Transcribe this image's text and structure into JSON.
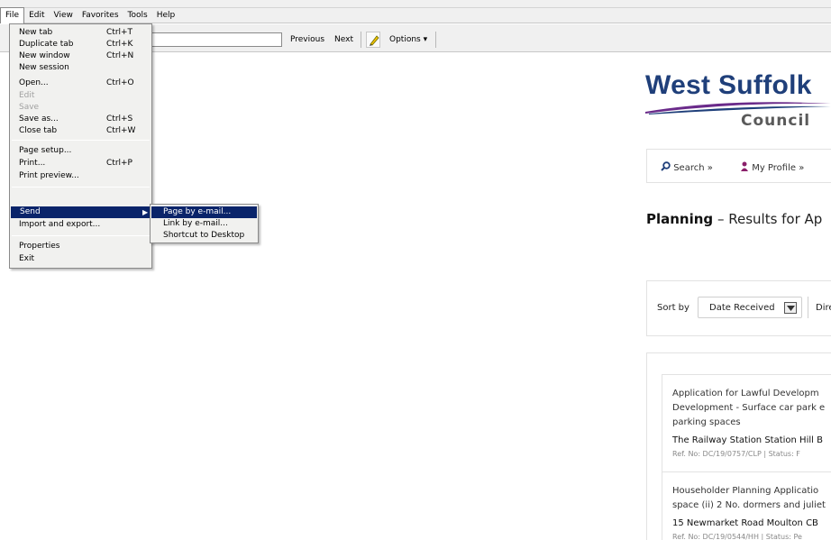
{
  "menubar": {
    "items": [
      "File",
      "Edit",
      "View",
      "Favorites",
      "Tools",
      "Help"
    ]
  },
  "findbar": {
    "search_value": "",
    "previous": "Previous",
    "next": "Next",
    "options": "Options"
  },
  "file_menu": {
    "items": [
      {
        "label": "New tab",
        "shortcut": "Ctrl+T"
      },
      {
        "label": "Duplicate tab",
        "shortcut": "Ctrl+K"
      },
      {
        "label": "New window",
        "shortcut": "Ctrl+N"
      },
      {
        "label": "New session",
        "shortcut": ""
      },
      {
        "label": "Open...",
        "shortcut": "Ctrl+O"
      },
      {
        "label": "Edit",
        "shortcut": ""
      },
      {
        "label": "Save",
        "shortcut": ""
      },
      {
        "label": "Save as...",
        "shortcut": "Ctrl+S"
      },
      {
        "label": "Close tab",
        "shortcut": "Ctrl+W"
      },
      {
        "label": "Page setup...",
        "shortcut": ""
      },
      {
        "label": "Print...",
        "shortcut": "Ctrl+P"
      },
      {
        "label": "Print preview...",
        "shortcut": ""
      },
      {
        "label": "Send",
        "shortcut": ""
      },
      {
        "label": "Import and export...",
        "shortcut": ""
      },
      {
        "label": "Properties",
        "shortcut": ""
      },
      {
        "label": "Exit",
        "shortcut": ""
      }
    ]
  },
  "send_submenu": {
    "items": [
      "Page by e-mail...",
      "Link by e-mail...",
      "Shortcut to Desktop"
    ]
  },
  "page": {
    "logo_main": "West Suffolk",
    "logo_sub": "Council",
    "nav": {
      "search": "Search",
      "profile": "My Profile"
    },
    "title_bold": "Planning",
    "title_rest": " –  Results for Ap",
    "sort": {
      "label": "Sort by",
      "value": "Date Received",
      "direction": "Dire"
    },
    "results": [
      {
        "desc": [
          "Application for Lawful Developm",
          "Development - Surface car park e",
          "parking spaces"
        ],
        "address": "The Railway Station Station Hill B",
        "meta": "Ref. No: DC/19/0757/CLP | Status: F"
      },
      {
        "desc": [
          "Householder Planning Applicatio",
          "space (ii) 2 No. dormers and juliet"
        ],
        "address": "15 Newmarket Road Moulton CB",
        "meta": "Ref. No: DC/19/0544/HH | Status: Pe"
      }
    ]
  },
  "colors": {
    "menu_highlight": "#0a246a",
    "logo_blue": "#1f3f7a",
    "logo_purple": "#6a2a8a"
  }
}
